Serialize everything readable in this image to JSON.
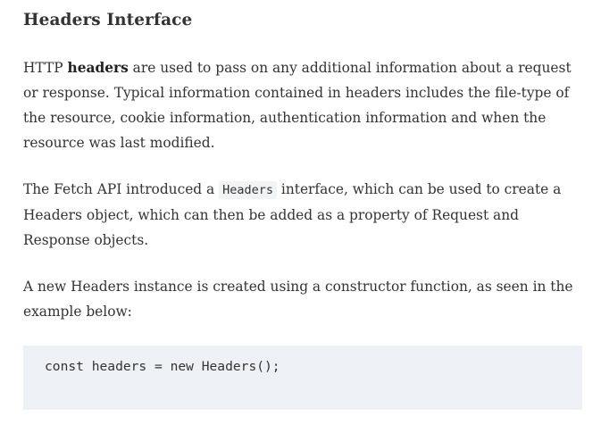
{
  "heading": "Headers Interface",
  "paragraph1": {
    "prefix": "HTTP ",
    "bold": "headers",
    "suffix": " are used to pass on any additional information about a request or response. Typical information contained in headers includes the file-type of the resource, cookie information, authentication information and when the resource was last modified."
  },
  "paragraph2": {
    "prefix": "The Fetch API introduced a ",
    "code": "Headers",
    "suffix": " interface, which can be used to create a Headers object, which can then be added as a property of Request and Response objects."
  },
  "paragraph3": {
    "text": "A new Headers instance is created using a constructor function, as seen in the ex­ample below:"
  },
  "code_block": {
    "code": "const headers = new Headers();"
  }
}
